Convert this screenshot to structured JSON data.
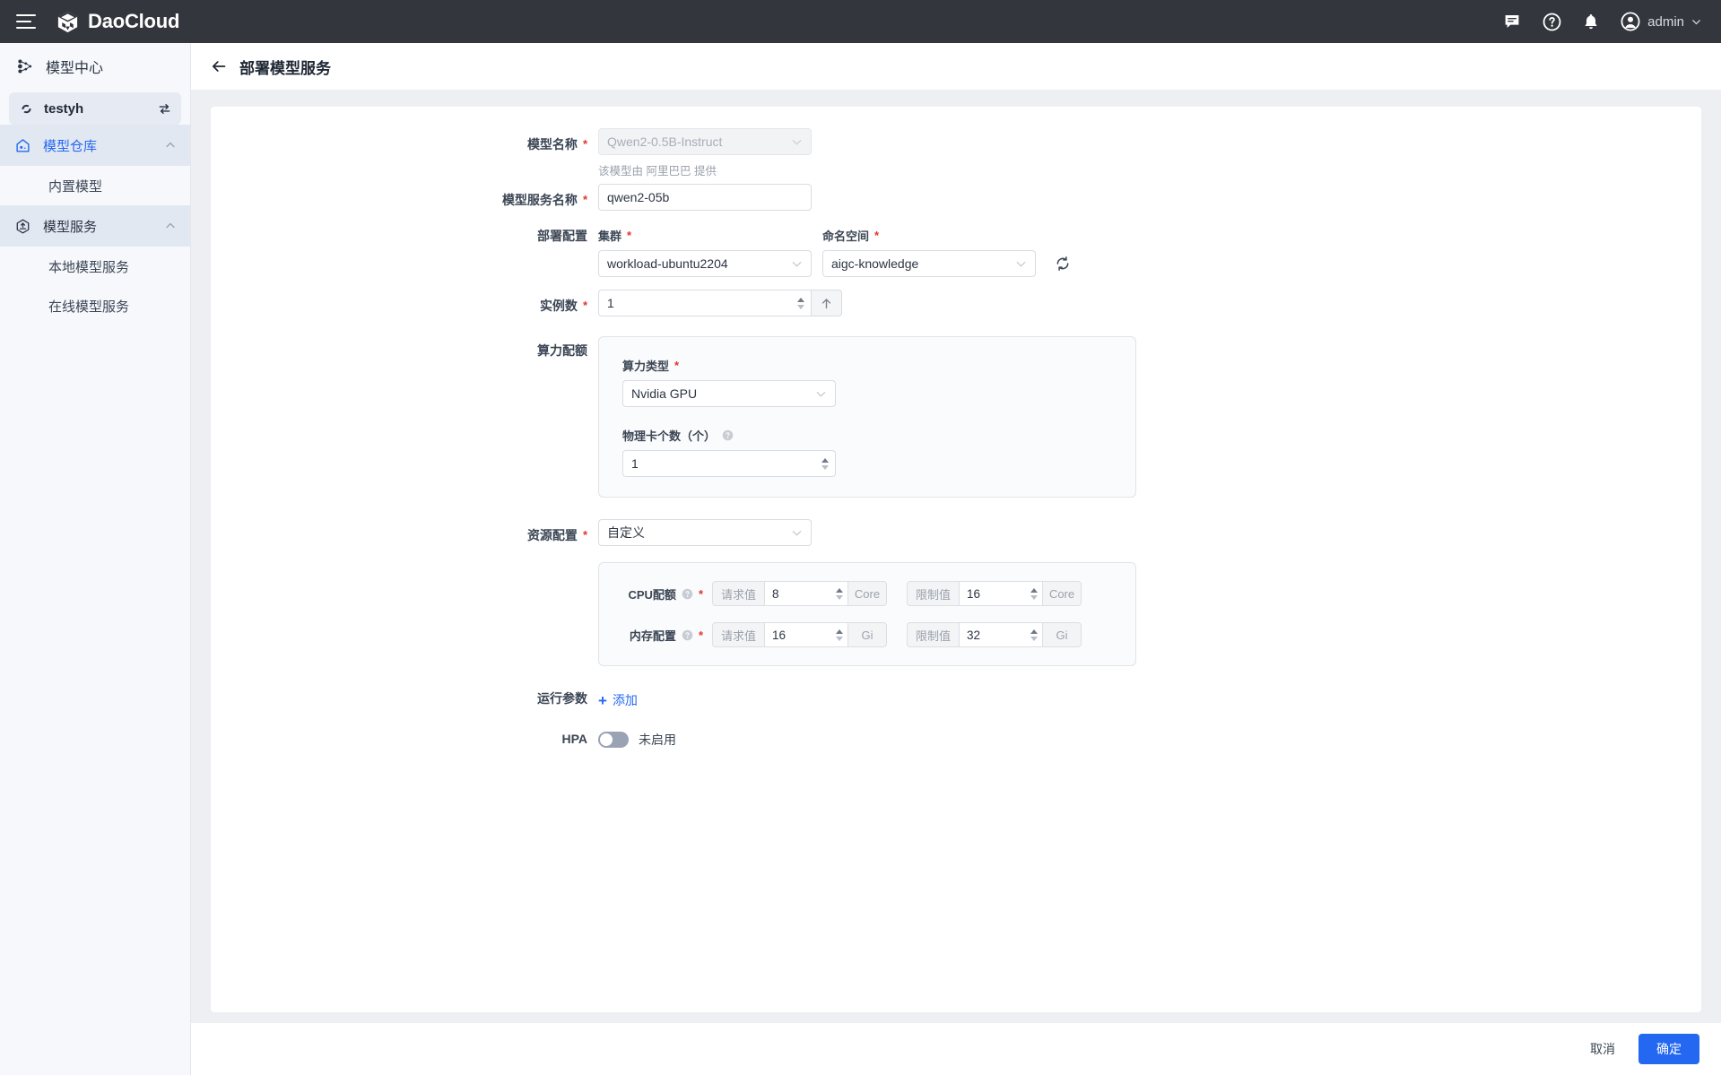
{
  "topbar": {
    "brand": "DaoCloud",
    "menu_icon": "hamburger-icon",
    "icons": [
      "chat-icon",
      "help-icon",
      "bell-icon"
    ],
    "user": "admin"
  },
  "sidebar": {
    "title": "模型中心",
    "workspace": "testyh",
    "groups": [
      {
        "label": "模型仓库",
        "active": true,
        "children": [
          {
            "label": "内置模型"
          }
        ]
      },
      {
        "label": "模型服务",
        "active": false,
        "children": [
          {
            "label": "本地模型服务"
          },
          {
            "label": "在线模型服务"
          }
        ]
      }
    ]
  },
  "page": {
    "title": "部署模型服务",
    "back_icon": "back-arrow-icon"
  },
  "form": {
    "model_name": {
      "label": "模型名称",
      "value": "Qwen2-0.5B-Instruct",
      "disabled": true,
      "hint": "该模型由 阿里巴巴 提供"
    },
    "service_name": {
      "label": "模型服务名称",
      "value": "qwen2-05b"
    },
    "deploy_config": {
      "label": "部署配置",
      "cluster": {
        "label": "集群",
        "value": "workload-ubuntu2204"
      },
      "namespace": {
        "label": "命名空间",
        "value": "aigc-knowledge"
      },
      "refresh_icon": "refresh-icon"
    },
    "replicas": {
      "label": "实例数",
      "value": "1",
      "action_icon": "arrow-up-icon"
    },
    "compute_quota": {
      "label": "算力配额",
      "type": {
        "label": "算力类型",
        "value": "Nvidia GPU"
      },
      "cards": {
        "label": "物理卡个数（个）",
        "value": "1",
        "help_icon": "question-icon"
      }
    },
    "resource_config": {
      "label": "资源配置",
      "value": "自定义",
      "rows": [
        {
          "label": "CPU配额",
          "help_icon": "question-icon",
          "request_label": "请求值",
          "request_value": "8",
          "request_unit": "Core",
          "limit_label": "限制值",
          "limit_value": "16",
          "limit_unit": "Core"
        },
        {
          "label": "内存配置",
          "help_icon": "question-icon",
          "request_label": "请求值",
          "request_value": "16",
          "request_unit": "Gi",
          "limit_label": "限制值",
          "limit_value": "32",
          "limit_unit": "Gi"
        }
      ]
    },
    "runtime_params": {
      "label": "运行参数",
      "add_label": "添加",
      "add_icon": "plus-icon"
    },
    "hpa": {
      "label": "HPA",
      "enabled": false,
      "state_text": "未启用"
    }
  },
  "footer": {
    "cancel": "取消",
    "confirm": "确定"
  },
  "colors": {
    "accent": "#2468f2",
    "topbar_bg": "#33363d",
    "sidebar_bg": "#f6f8fb",
    "page_bg": "#edeff3",
    "required": "#e3342f"
  }
}
